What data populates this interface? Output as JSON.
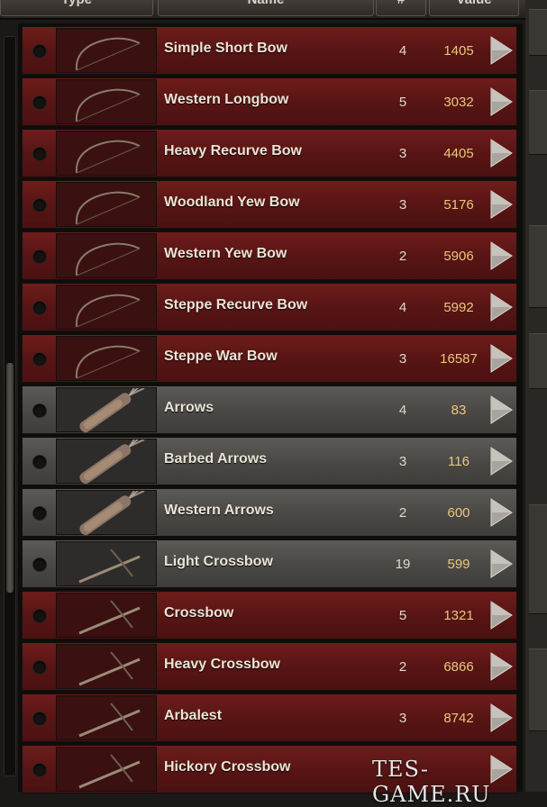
{
  "header": {
    "columns": [
      "Type",
      "Name",
      "#",
      "Value"
    ]
  },
  "items": [
    {
      "name": "Simple Short Bow",
      "qty": "4",
      "value": "1405",
      "kind": "weapon",
      "icon": "bow-icon"
    },
    {
      "name": "Western Longbow",
      "qty": "5",
      "value": "3032",
      "kind": "weapon",
      "icon": "bow-icon"
    },
    {
      "name": "Heavy Recurve Bow",
      "qty": "3",
      "value": "4405",
      "kind": "weapon",
      "icon": "bow-icon"
    },
    {
      "name": "Woodland Yew Bow",
      "qty": "3",
      "value": "5176",
      "kind": "weapon",
      "icon": "bow-icon"
    },
    {
      "name": "Western Yew Bow",
      "qty": "2",
      "value": "5906",
      "kind": "weapon",
      "icon": "bow-icon"
    },
    {
      "name": "Steppe Recurve Bow",
      "qty": "4",
      "value": "5992",
      "kind": "weapon",
      "icon": "bow-icon"
    },
    {
      "name": "Steppe War Bow",
      "qty": "3",
      "value": "16587",
      "kind": "weapon",
      "icon": "bow-icon"
    },
    {
      "name": "Arrows",
      "qty": "4",
      "value": "83",
      "kind": "ammo",
      "icon": "quiver-icon"
    },
    {
      "name": "Barbed Arrows",
      "qty": "3",
      "value": "116",
      "kind": "ammo",
      "icon": "quiver-icon"
    },
    {
      "name": "Western Arrows",
      "qty": "2",
      "value": "600",
      "kind": "ammo",
      "icon": "quiver-icon"
    },
    {
      "name": "Light Crossbow",
      "qty": "19",
      "value": "599",
      "kind": "ammo",
      "icon": "crossbow-icon"
    },
    {
      "name": "Crossbow",
      "qty": "5",
      "value": "1321",
      "kind": "weapon",
      "icon": "crossbow-icon"
    },
    {
      "name": "Heavy Crossbow",
      "qty": "2",
      "value": "6866",
      "kind": "weapon",
      "icon": "crossbow-icon"
    },
    {
      "name": "Arbalest",
      "qty": "3",
      "value": "8742",
      "kind": "weapon",
      "icon": "crossbow-icon"
    },
    {
      "name": "Hickory Crossbow",
      "qty": "",
      "value": "",
      "kind": "weapon",
      "icon": "crossbow-icon"
    }
  ],
  "watermark": "TES-GAME.RU",
  "colors": {
    "weapon_row": "#5a1615",
    "ammo_row": "#4a4845",
    "value_text": "#e9c77d",
    "name_text": "#ece4d6"
  }
}
